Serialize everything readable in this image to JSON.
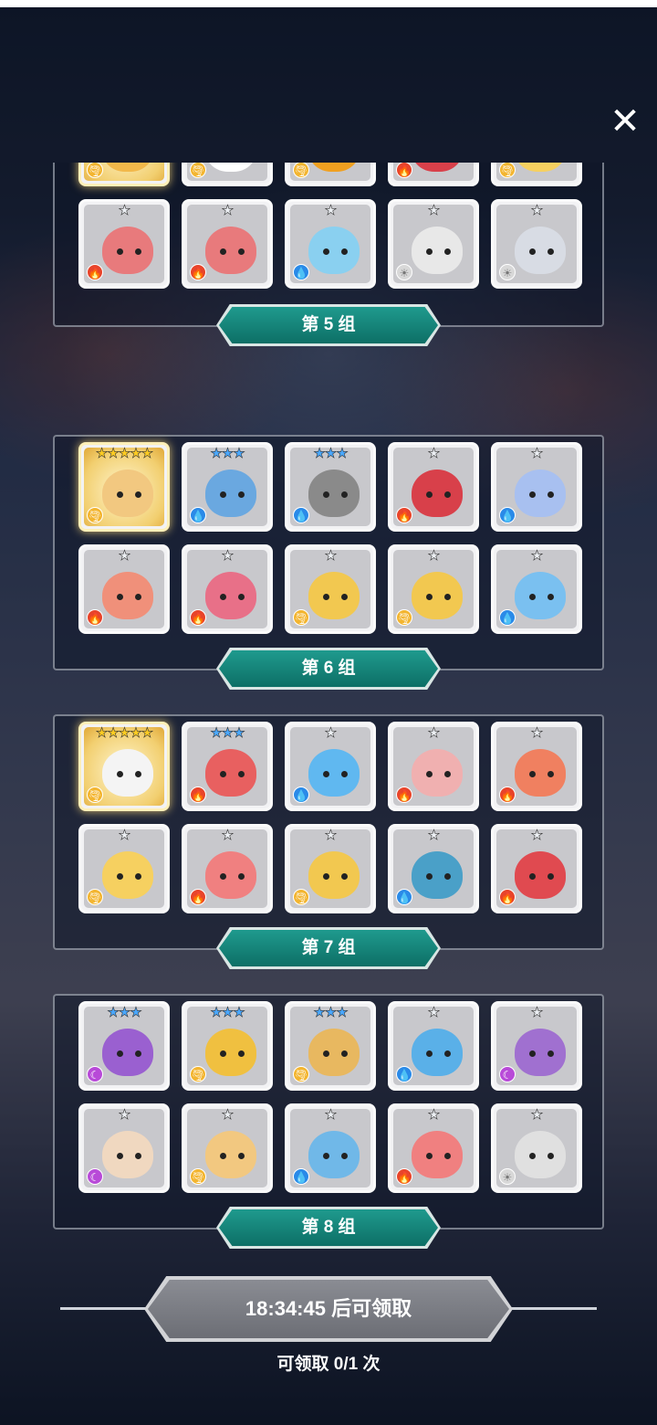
{
  "close": {
    "label": "✕"
  },
  "groups": [
    {
      "label": "第 5 组",
      "partial": true,
      "cards": [
        {
          "stars": "★★★★★",
          "rarity": "gold",
          "element": "wind",
          "color": "#f2b84a"
        },
        {
          "stars": "★★★",
          "rarity": "blue",
          "element": "wind",
          "color": "#ffffff"
        },
        {
          "stars": "★★★",
          "rarity": "blue",
          "element": "wind",
          "color": "#f0a020"
        },
        {
          "stars": "★",
          "rarity": "gray",
          "element": "fire",
          "color": "#d8404a"
        },
        {
          "stars": "★",
          "rarity": "gray",
          "element": "wind",
          "color": "#f6d060"
        },
        {
          "stars": "★",
          "rarity": "gray",
          "element": "fire",
          "color": "#e87a7c"
        },
        {
          "stars": "★",
          "rarity": "gray",
          "element": "fire",
          "color": "#e87a7c"
        },
        {
          "stars": "★",
          "rarity": "gray",
          "element": "water",
          "color": "#8ad0f0"
        },
        {
          "stars": "★",
          "rarity": "gray",
          "element": "light",
          "color": "#e8e8e8"
        },
        {
          "stars": "★",
          "rarity": "gray",
          "element": "light",
          "color": "#d8dce4"
        }
      ]
    },
    {
      "label": "第 6 组",
      "partial": false,
      "cards": [
        {
          "stars": "★★★★★",
          "rarity": "gold",
          "element": "wind",
          "color": "#f2c880"
        },
        {
          "stars": "★★★",
          "rarity": "blue",
          "element": "water",
          "color": "#6aa8e0"
        },
        {
          "stars": "★★★",
          "rarity": "blue",
          "element": "water",
          "color": "#8a8a8a"
        },
        {
          "stars": "★",
          "rarity": "gray",
          "element": "fire",
          "color": "#d8404a"
        },
        {
          "stars": "★",
          "rarity": "gray",
          "element": "water",
          "color": "#a8c0f0"
        },
        {
          "stars": "★",
          "rarity": "gray",
          "element": "fire",
          "color": "#f0907a"
        },
        {
          "stars": "★",
          "rarity": "gray",
          "element": "fire",
          "color": "#e87088"
        },
        {
          "stars": "★",
          "rarity": "gray",
          "element": "wind",
          "color": "#f2c850"
        },
        {
          "stars": "★",
          "rarity": "gray",
          "element": "wind",
          "color": "#f2c850"
        },
        {
          "stars": "★",
          "rarity": "gray",
          "element": "water",
          "color": "#7ac0f0"
        }
      ]
    },
    {
      "label": "第 7 组",
      "partial": false,
      "cards": [
        {
          "stars": "★★★★★",
          "rarity": "gold",
          "element": "wind",
          "color": "#f4f4f4"
        },
        {
          "stars": "★★★",
          "rarity": "blue",
          "element": "fire",
          "color": "#e86060"
        },
        {
          "stars": "★",
          "rarity": "gray",
          "element": "water",
          "color": "#60b8f0"
        },
        {
          "stars": "★",
          "rarity": "gray",
          "element": "fire",
          "color": "#f0b0b0"
        },
        {
          "stars": "★",
          "rarity": "gray",
          "element": "fire",
          "color": "#f08060"
        },
        {
          "stars": "★",
          "rarity": "gray",
          "element": "wind",
          "color": "#f6d060"
        },
        {
          "stars": "★",
          "rarity": "gray",
          "element": "fire",
          "color": "#f08080"
        },
        {
          "stars": "★",
          "rarity": "gray",
          "element": "wind",
          "color": "#f2c850"
        },
        {
          "stars": "★",
          "rarity": "gray",
          "element": "water",
          "color": "#4aa0c8"
        },
        {
          "stars": "★",
          "rarity": "gray",
          "element": "fire",
          "color": "#e04a50"
        }
      ]
    },
    {
      "label": "第 8 组",
      "partial": false,
      "cards": [
        {
          "stars": "★★★",
          "rarity": "blue",
          "element": "dark",
          "color": "#9a60d0"
        },
        {
          "stars": "★★★",
          "rarity": "blue",
          "element": "wind",
          "color": "#f0c040"
        },
        {
          "stars": "★★★",
          "rarity": "blue",
          "element": "wind",
          "color": "#e8b860"
        },
        {
          "stars": "★",
          "rarity": "gray",
          "element": "water",
          "color": "#5ab0e8"
        },
        {
          "stars": "★",
          "rarity": "gray",
          "element": "dark",
          "color": "#a070d0"
        },
        {
          "stars": "★",
          "rarity": "gray",
          "element": "dark",
          "color": "#f0d8c0"
        },
        {
          "stars": "★",
          "rarity": "gray",
          "element": "wind",
          "color": "#f2c880"
        },
        {
          "stars": "★",
          "rarity": "gray",
          "element": "water",
          "color": "#70b8e8"
        },
        {
          "stars": "★",
          "rarity": "gray",
          "element": "fire",
          "color": "#f08080"
        },
        {
          "stars": "★",
          "rarity": "gray",
          "element": "light",
          "color": "#e0e0e0"
        }
      ]
    }
  ],
  "element_icons": {
    "fire": "🔥",
    "water": "💧",
    "wind": "🌪",
    "light": "☀",
    "dark": "☾"
  },
  "claim": {
    "button_label": "18:34:45 后可领取",
    "count_label": "可领取 0/1 次"
  }
}
